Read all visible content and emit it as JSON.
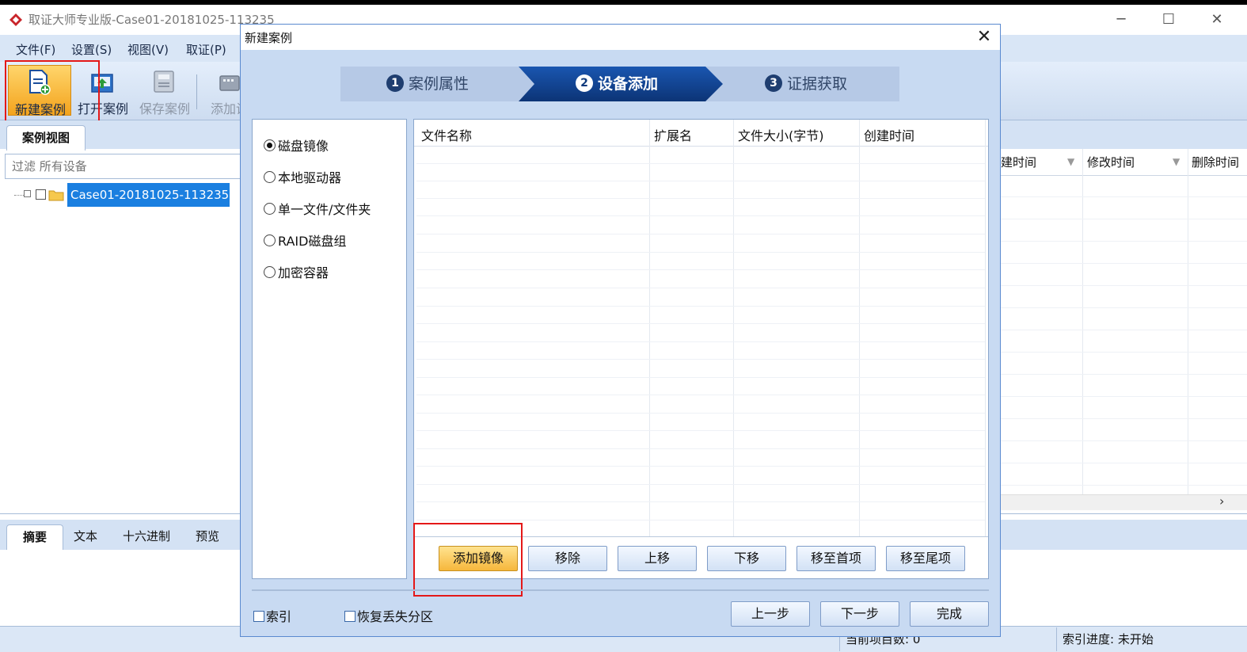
{
  "app": {
    "title": "取证大师专业版-Case01-20181025-113235"
  },
  "window_controls": {
    "minimize": "─",
    "maximize": "☐",
    "close": "✕"
  },
  "menu": [
    "文件(F)",
    "设置(S)",
    "视图(V)",
    "取证(P)"
  ],
  "toolbar": {
    "new_case": "新建案例",
    "open_case": "打开案例",
    "save_case": "保存案例",
    "add_device": "添加设"
  },
  "left_pane": {
    "tab": "案例视图",
    "filter_placeholder": "过滤 所有设备",
    "tree_node": "Case01-20181025-113235"
  },
  "bottom_tabs": [
    "摘要",
    "文本",
    "十六进制",
    "预览"
  ],
  "right_pane": {
    "columns": [
      "建时间",
      "修改时间",
      "删除时间"
    ],
    "scroll_arrow": "›"
  },
  "status": {
    "count": "当前项目数: 0",
    "index_progress": "索引进度: 未开始"
  },
  "dialog": {
    "title": "新建案例",
    "close": "✕",
    "steps": [
      {
        "num": "1",
        "label": "案例属性"
      },
      {
        "num": "2",
        "label": "设备添加"
      },
      {
        "num": "3",
        "label": "证据获取"
      }
    ],
    "source_types": [
      "磁盘镜像",
      "本地驱动器",
      "单一文件/文件夹",
      "RAID磁盘组",
      "加密容器"
    ],
    "selected_source": "磁盘镜像",
    "columns": [
      "文件名称",
      "扩展名",
      "文件大小(字节)",
      "创建时间"
    ],
    "list_buttons": {
      "add_image": "添加镜像",
      "remove": "移除",
      "move_up": "上移",
      "move_down": "下移",
      "move_first": "移至首项",
      "move_last": "移至尾项"
    },
    "checkboxes": {
      "index": "索引",
      "recover_partition": "恢复丢失分区"
    },
    "nav": {
      "prev": "上一步",
      "next": "下一步",
      "finish": "完成"
    }
  },
  "colors": {
    "accent_blue": "#1a4f9c",
    "highlight_red": "#e41818",
    "button_orange": "#f6b73c",
    "selection_blue": "#1a7fe0"
  }
}
